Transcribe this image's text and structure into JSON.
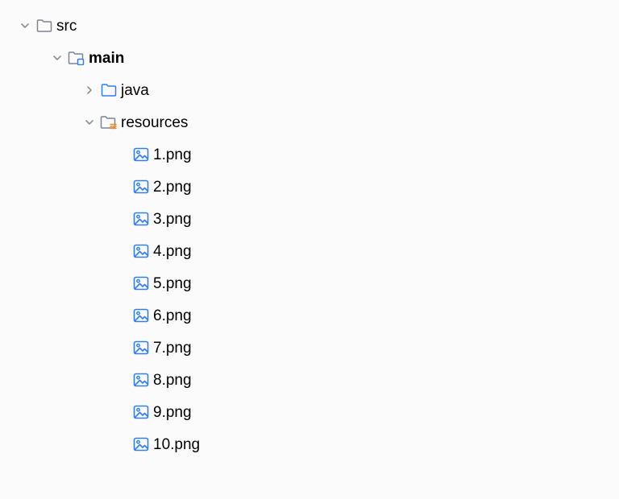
{
  "tree": {
    "src": "src",
    "main": "main",
    "java": "java",
    "resources": "resources",
    "files": [
      "1.png",
      "2.png",
      "3.png",
      "4.png",
      "5.png",
      "6.png",
      "7.png",
      "8.png",
      "9.png",
      "10.png"
    ]
  }
}
